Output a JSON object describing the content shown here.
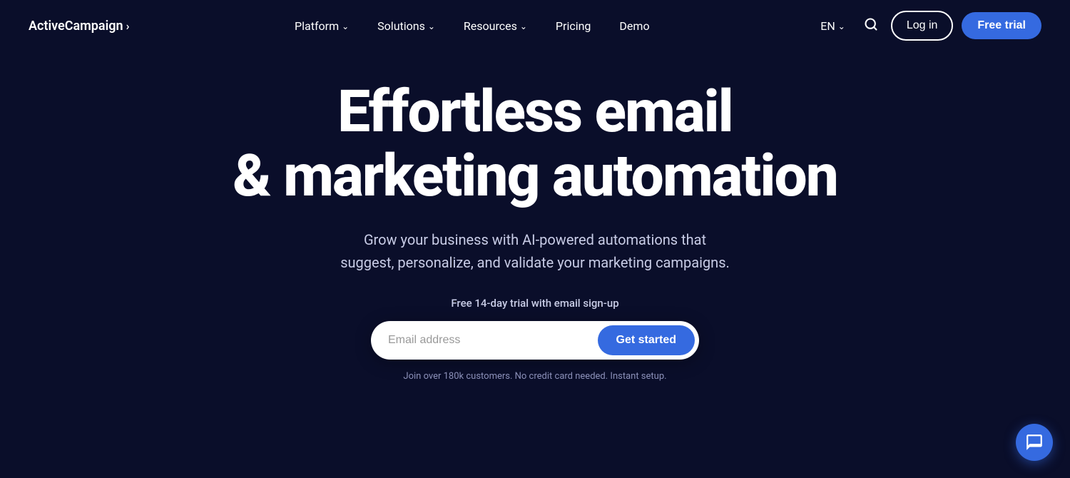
{
  "brand": {
    "name": "ActiveCampaign",
    "arrow": "›"
  },
  "nav": {
    "items": [
      {
        "label": "Platform",
        "hasDropdown": true
      },
      {
        "label": "Solutions",
        "hasDropdown": true
      },
      {
        "label": "Resources",
        "hasDropdown": true
      },
      {
        "label": "Pricing",
        "hasDropdown": false
      },
      {
        "label": "Demo",
        "hasDropdown": false
      }
    ],
    "lang": "EN",
    "login_label": "Log in",
    "free_trial_label": "Free trial"
  },
  "hero": {
    "title_line1": "Effortless email",
    "title_line2": "& marketing automation",
    "subtitle": "Grow your business with AI-powered automations that suggest, personalize, and validate your marketing campaigns.",
    "trial_label": "Free 14-day trial with email sign-up",
    "email_placeholder": "Email address",
    "cta_label": "Get started",
    "disclaimer": "Join over 180k customers. No credit card needed. Instant setup."
  }
}
